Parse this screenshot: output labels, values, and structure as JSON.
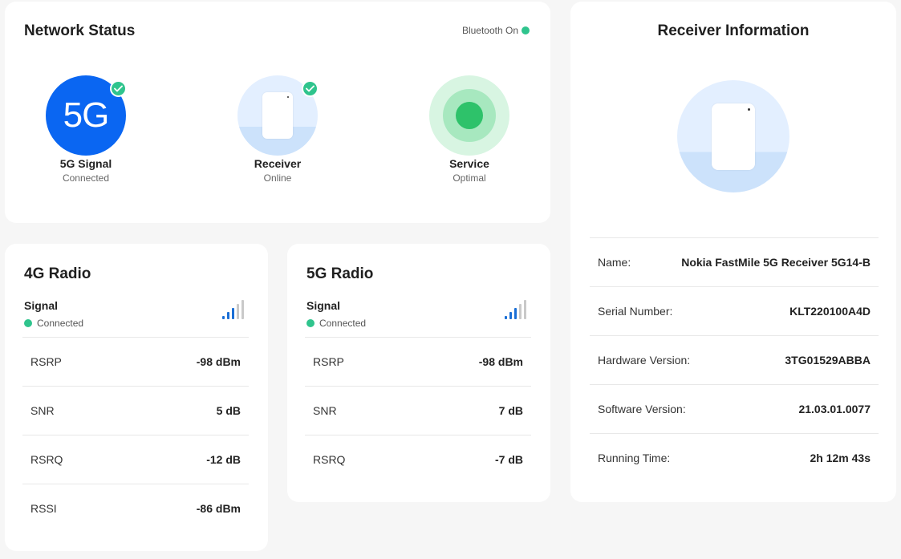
{
  "network_status": {
    "title": "Network Status",
    "bluetooth": "Bluetooth On",
    "items": [
      {
        "circle_text": "5G",
        "label": "5G Signal",
        "status": "Connected"
      },
      {
        "label": "Receiver",
        "status": "Online"
      },
      {
        "label": "Service",
        "status": "Optimal"
      }
    ]
  },
  "radio_4g": {
    "title": "4G Radio",
    "signal_label": "Signal",
    "signal_status": "Connected",
    "signal_level": 3,
    "signal_max": 5,
    "metrics": [
      {
        "label": "RSRP",
        "value": "-98 dBm"
      },
      {
        "label": "SNR",
        "value": "5 dB"
      },
      {
        "label": "RSRQ",
        "value": "-12 dB"
      },
      {
        "label": "RSSI",
        "value": "-86 dBm"
      }
    ]
  },
  "radio_5g": {
    "title": "5G Radio",
    "signal_label": "Signal",
    "signal_status": "Connected",
    "signal_level": 3,
    "signal_max": 5,
    "metrics": [
      {
        "label": "RSRP",
        "value": "-98 dBm"
      },
      {
        "label": "SNR",
        "value": "7 dB"
      },
      {
        "label": "RSRQ",
        "value": "-7 dB"
      }
    ]
  },
  "receiver_info": {
    "title": "Receiver Information",
    "rows": [
      {
        "label": "Name:",
        "value": "Nokia FastMile 5G Receiver 5G14-B"
      },
      {
        "label": "Serial Number:",
        "value": "KLT220100A4D"
      },
      {
        "label": "Hardware Version:",
        "value": "3TG01529ABBA"
      },
      {
        "label": "Software Version:",
        "value": "21.03.01.0077"
      },
      {
        "label": "Running Time:",
        "value": "2h 12m 43s"
      }
    ]
  },
  "colors": {
    "accent_blue": "#0a66f2",
    "status_green": "#2fc48d",
    "service_green": "#2ec26a",
    "signal_bar_active": "#1a6fd6",
    "signal_bar_inactive": "#c9c9c9"
  },
  "icons": [
    "check-icon",
    "signal-bars-icon",
    "receiver-device-icon",
    "service-dot-icon",
    "status-dot-icon"
  ]
}
